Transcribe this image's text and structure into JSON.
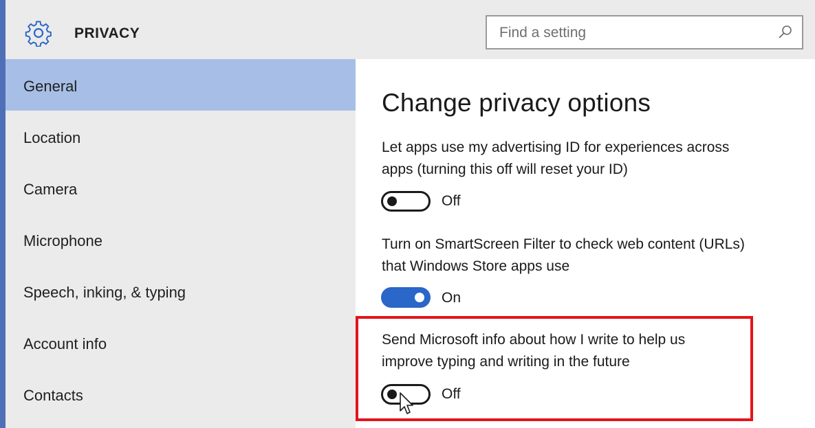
{
  "header": {
    "title": "PRIVACY",
    "gear_icon": "gear-icon",
    "search": {
      "placeholder": "Find a setting",
      "value": "",
      "icon": "search-icon"
    }
  },
  "sidebar": {
    "items": [
      {
        "label": "General",
        "active": true
      },
      {
        "label": "Location",
        "active": false
      },
      {
        "label": "Camera",
        "active": false
      },
      {
        "label": "Microphone",
        "active": false
      },
      {
        "label": "Speech, inking, & typing",
        "active": false
      },
      {
        "label": "Account info",
        "active": false
      },
      {
        "label": "Contacts",
        "active": false
      }
    ]
  },
  "main": {
    "heading": "Change privacy options",
    "settings": [
      {
        "line1": "Let apps use my advertising ID for experiences across",
        "line2": "apps (turning this off will reset your ID)",
        "state": "Off",
        "on": false
      },
      {
        "line1": "Turn on SmartScreen Filter to check web content (URLs)",
        "line2": "that Windows Store apps use",
        "state": "On",
        "on": true
      },
      {
        "line1": "Send Microsoft info about how I write to help us",
        "line2": "improve typing and writing in the future",
        "state": "Off",
        "on": false
      }
    ]
  },
  "colors": {
    "accent": "#2b66c9",
    "sidebar_bg": "#ebebeb",
    "active_item_bg": "#a7bfe6",
    "highlight_border": "#e3141b",
    "left_strip": "#4f6fb7"
  }
}
